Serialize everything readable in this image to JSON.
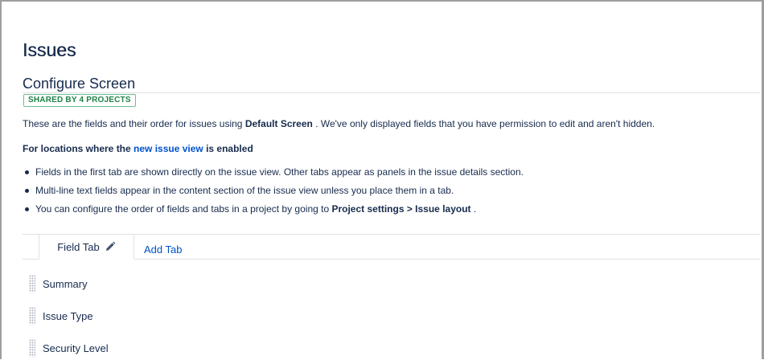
{
  "header": {
    "page_title": "Issues",
    "section_title": "Configure Screen",
    "badge": "SHARED BY 4 PROJECTS"
  },
  "description": {
    "prefix": "These are the fields and their order for issues using ",
    "screen_name": "Default Screen",
    "suffix": " . We've only displayed fields that you have permission to edit and aren't hidden."
  },
  "locations": {
    "prefix": "For locations where the ",
    "link_text": "new issue view",
    "suffix": " is enabled"
  },
  "bullets": [
    {
      "text": "Fields in the first tab are shown directly on the issue view. Other tabs appear as panels in the issue details section."
    },
    {
      "text": "Multi-line text fields appear in the content section of the issue view unless you place them in a tab."
    },
    {
      "prefix": "You can configure the order of fields and tabs in a project by going to ",
      "bold": "Project settings > Issue layout",
      "suffix": " ."
    }
  ],
  "tabs": {
    "active_label": "Field Tab",
    "edit_icon": "pencil-icon",
    "add_label": "Add Tab"
  },
  "fields": [
    {
      "label": "Summary"
    },
    {
      "label": "Issue Type"
    },
    {
      "label": "Security Level"
    }
  ],
  "colors": {
    "heading": "#172b4d",
    "link": "#0052cc",
    "badge_text": "#1e8247",
    "badge_border": "#6fbd8e",
    "divider": "#dfe1e6"
  }
}
